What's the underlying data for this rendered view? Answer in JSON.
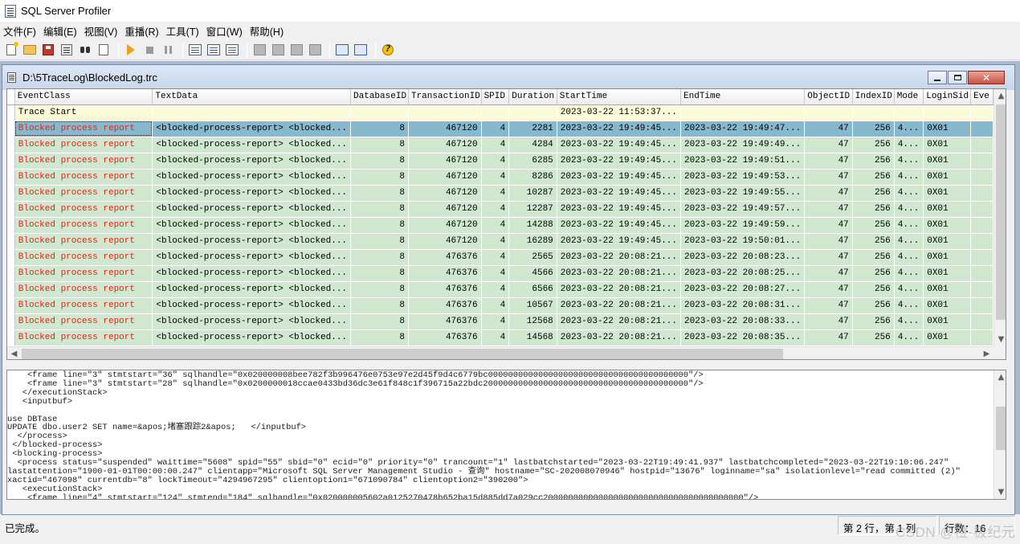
{
  "app": {
    "title": "SQL Server Profiler"
  },
  "menu": [
    {
      "label": "文件(F)"
    },
    {
      "label": "编辑(E)"
    },
    {
      "label": "视图(V)"
    },
    {
      "label": "重播(R)"
    },
    {
      "label": "工具(T)"
    },
    {
      "label": "窗口(W)"
    },
    {
      "label": "帮助(H)"
    }
  ],
  "toolbar": {
    "icons": [
      "new-trace-icon",
      "open-icon",
      "save-icon",
      "properties-icon",
      "find-icon",
      "clear-icon",
      "run-icon",
      "stop-icon",
      "pause-icon",
      "events-icon",
      "grid-icon",
      "template-icon",
      "gray-icon-1",
      "gray-icon-2",
      "gray-icon-3",
      "gray-icon-4",
      "blue-icon-1",
      "blue-icon-2",
      "help-icon"
    ]
  },
  "document": {
    "title": "D:\\5TraceLog\\BlockedLog.trc"
  },
  "grid": {
    "columns": [
      "EventClass",
      "TextData",
      "DatabaseID",
      "TransactionID",
      "SPID",
      "Duration",
      "StartTime",
      "EndTime",
      "ObjectID",
      "IndexID",
      "Mode",
      "LoginSid",
      "Eve"
    ],
    "selected_row": 1,
    "rows": [
      {
        "kind": "start",
        "cells": [
          "Trace Start",
          "",
          "",
          "",
          "",
          "",
          "2023-03-22 11:53:37...",
          "",
          "",
          "",
          "",
          "",
          ""
        ]
      },
      {
        "kind": "block",
        "cells": [
          "Blocked process report",
          "<blocked-process-report>   <blocked...",
          "8",
          "467120",
          "4",
          "2281",
          "2023-03-22 19:49:45...",
          "2023-03-22 19:49:47...",
          "47",
          "256",
          "4...",
          "0X01",
          ""
        ]
      },
      {
        "kind": "block",
        "cells": [
          "Blocked process report",
          "<blocked-process-report>   <blocked...",
          "8",
          "467120",
          "4",
          "4284",
          "2023-03-22 19:49:45...",
          "2023-03-22 19:49:49...",
          "47",
          "256",
          "4...",
          "0X01",
          ""
        ]
      },
      {
        "kind": "block",
        "cells": [
          "Blocked process report",
          "<blocked-process-report>   <blocked...",
          "8",
          "467120",
          "4",
          "6285",
          "2023-03-22 19:49:45...",
          "2023-03-22 19:49:51...",
          "47",
          "256",
          "4...",
          "0X01",
          ""
        ]
      },
      {
        "kind": "block",
        "cells": [
          "Blocked process report",
          "<blocked-process-report>   <blocked...",
          "8",
          "467120",
          "4",
          "8286",
          "2023-03-22 19:49:45...",
          "2023-03-22 19:49:53...",
          "47",
          "256",
          "4...",
          "0X01",
          ""
        ]
      },
      {
        "kind": "block",
        "cells": [
          "Blocked process report",
          "<blocked-process-report>   <blocked...",
          "8",
          "467120",
          "4",
          "10287",
          "2023-03-22 19:49:45...",
          "2023-03-22 19:49:55...",
          "47",
          "256",
          "4...",
          "0X01",
          ""
        ]
      },
      {
        "kind": "block",
        "cells": [
          "Blocked process report",
          "<blocked-process-report>   <blocked...",
          "8",
          "467120",
          "4",
          "12287",
          "2023-03-22 19:49:45...",
          "2023-03-22 19:49:57...",
          "47",
          "256",
          "4...",
          "0X01",
          ""
        ]
      },
      {
        "kind": "block",
        "cells": [
          "Blocked process report",
          "<blocked-process-report>   <blocked...",
          "8",
          "467120",
          "4",
          "14288",
          "2023-03-22 19:49:45...",
          "2023-03-22 19:49:59...",
          "47",
          "256",
          "4...",
          "0X01",
          ""
        ]
      },
      {
        "kind": "block",
        "cells": [
          "Blocked process report",
          "<blocked-process-report>   <blocked...",
          "8",
          "467120",
          "4",
          "16289",
          "2023-03-22 19:49:45...",
          "2023-03-22 19:50:01...",
          "47",
          "256",
          "4...",
          "0X01",
          ""
        ]
      },
      {
        "kind": "block",
        "cells": [
          "Blocked process report",
          "<blocked-process-report>   <blocked...",
          "8",
          "476376",
          "4",
          "2565",
          "2023-03-22 20:08:21...",
          "2023-03-22 20:08:23...",
          "47",
          "256",
          "4...",
          "0X01",
          ""
        ]
      },
      {
        "kind": "block",
        "cells": [
          "Blocked process report",
          "<blocked-process-report>   <blocked...",
          "8",
          "476376",
          "4",
          "4566",
          "2023-03-22 20:08:21...",
          "2023-03-22 20:08:25...",
          "47",
          "256",
          "4...",
          "0X01",
          ""
        ]
      },
      {
        "kind": "block",
        "cells": [
          "Blocked process report",
          "<blocked-process-report>   <blocked...",
          "8",
          "476376",
          "4",
          "6566",
          "2023-03-22 20:08:21...",
          "2023-03-22 20:08:27...",
          "47",
          "256",
          "4...",
          "0X01",
          ""
        ]
      },
      {
        "kind": "block",
        "cells": [
          "Blocked process report",
          "<blocked-process-report>   <blocked...",
          "8",
          "476376",
          "4",
          "10567",
          "2023-03-22 20:08:21...",
          "2023-03-22 20:08:31...",
          "47",
          "256",
          "4...",
          "0X01",
          ""
        ]
      },
      {
        "kind": "block",
        "cells": [
          "Blocked process report",
          "<blocked-process-report>   <blocked...",
          "8",
          "476376",
          "4",
          "12568",
          "2023-03-22 20:08:21...",
          "2023-03-22 20:08:33...",
          "47",
          "256",
          "4...",
          "0X01",
          ""
        ]
      },
      {
        "kind": "block",
        "cells": [
          "Blocked process report",
          "<blocked-process-report>   <blocked...",
          "8",
          "476376",
          "4",
          "14568",
          "2023-03-22 20:08:21...",
          "2023-03-22 20:08:35...",
          "47",
          "256",
          "4...",
          "0X01",
          ""
        ]
      }
    ]
  },
  "textdata": {
    "lines": [
      "    <frame line=\"3\" stmtstart=\"36\" sqlhandle=\"0x020000008bee782f3b996476e0753e97e2d45f9d4c6779bc0000000000000000000000000000000000000000\"/>",
      "    <frame line=\"3\" stmtstart=\"28\" sqlhandle=\"0x0200000018ccae0433bd36dc3e61f848c1f396715a22bdc20000000000000000000000000000000000000000\"/>",
      "   </executionStack>",
      "   <inputbuf>",
      "",
      "use DBTase",
      "UPDATE dbo.user2 SET name=&apos;堵塞跟踪2&apos;   </inputbuf>",
      "  </process>",
      " </blocked-process>",
      " <blocking-process>",
      "  <process status=\"suspended\" waittime=\"5608\" spid=\"55\" sbid=\"0\" ecid=\"0\" priority=\"0\" trancount=\"1\" lastbatchstarted=\"2023-03-22T19:49:41.937\" lastbatchcompleted=\"2023-03-22T19:10:06.247\"",
      "lastattention=\"1900-01-01T00:00:00.247\" clientapp=\"Microsoft SQL Server Management Studio - 查询\" hostname=\"SC-202008070946\" hostpid=\"13676\" loginname=\"sa\" isolationlevel=\"read committed (2)\"",
      "xactid=\"467098\" currentdb=\"8\" lockTimeout=\"4294967295\" clientoption1=\"671090784\" clientoption2=\"390200\">",
      "   <executionStack>",
      "    <frame line=\"4\" stmtstart=\"124\" stmtend=\"184\" sqlhandle=\"0x020000005602a0125270478b652ba15d885dd7a029cc2000000000000000000000000000000000000000\"/>"
    ]
  },
  "status": {
    "message": "已完成。",
    "position": "第 2 行，第 1 列",
    "rows": "行数：16",
    "watermark": "CSDN @橙-极纪元"
  }
}
